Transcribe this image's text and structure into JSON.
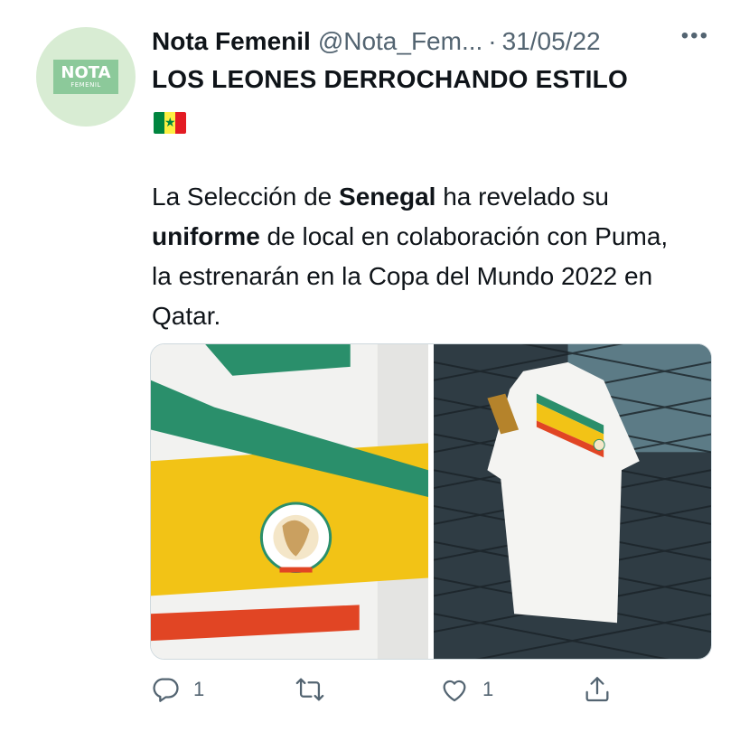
{
  "tweet": {
    "avatar": {
      "line1": "NOTA",
      "line2": "FEMENIL",
      "colors": {
        "bg": "#d8ecd3",
        "badge": "#8cc99a"
      }
    },
    "display_name": "Nota Femenil",
    "handle": "@Nota_Fem...",
    "separator": "·",
    "date": "31/05/22",
    "more_label": "•••",
    "headline": "LOS LEONES DERROCHANDO ESTILO",
    "flag_icon": "senegal-flag",
    "body": {
      "p1": "La Selección de ",
      "b1": "Senegal",
      "p2": " ha revelado su ",
      "b2": "uniforme",
      "p3": " de local en colaboración con Puma, la estrenarán en la Copa del Mundo 2022 en Qatar."
    },
    "media": [
      {
        "icon": "jersey-closeup-photo"
      },
      {
        "icon": "jersey-on-fence-photo"
      }
    ],
    "actions": {
      "reply": {
        "icon": "reply-icon",
        "count": "1"
      },
      "retweet": {
        "icon": "retweet-icon",
        "count": ""
      },
      "like": {
        "icon": "heart-icon",
        "count": "1"
      },
      "share": {
        "icon": "share-icon",
        "count": ""
      }
    },
    "colors": {
      "text": "#0f1419",
      "secondary": "#536471",
      "border": "#cfd9de"
    }
  }
}
